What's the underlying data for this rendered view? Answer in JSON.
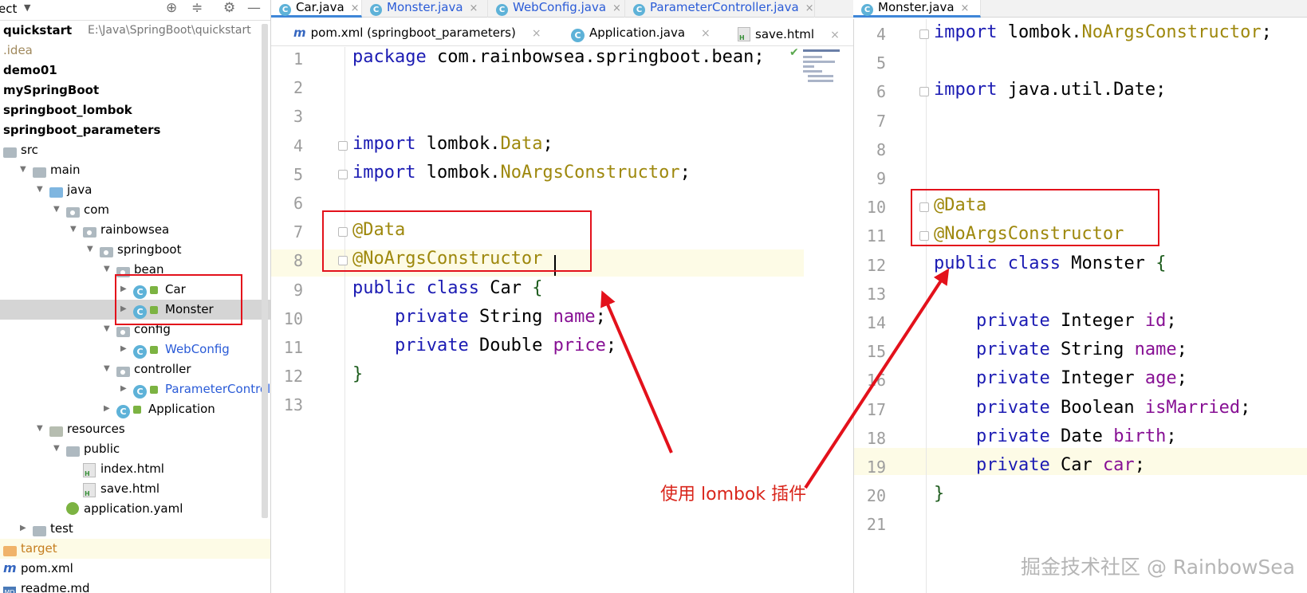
{
  "project": {
    "title": "ect",
    "tree": [
      {
        "label": "quickstart",
        "path": "E:\\Java\\SpringBoot\\quickstart",
        "style": "bold",
        "icon": "none",
        "indent": 0,
        "arrow": ""
      },
      {
        "label": ".idea",
        "style": "dimorange",
        "icon": "none",
        "indent": 0,
        "arrow": ""
      },
      {
        "label": "demo01",
        "style": "bold",
        "icon": "none",
        "indent": 0,
        "arrow": ""
      },
      {
        "label": "mySpringBoot",
        "style": "bold",
        "icon": "none",
        "indent": 0,
        "arrow": ""
      },
      {
        "label": "springboot_lombok",
        "style": "bold",
        "icon": "none",
        "indent": 0,
        "arrow": ""
      },
      {
        "label": "springboot_parameters",
        "style": "bold",
        "icon": "none",
        "indent": 0,
        "arrow": ""
      },
      {
        "label": "src",
        "style": "",
        "icon": "folder",
        "indent": 0,
        "arrow": ""
      },
      {
        "label": "main",
        "style": "",
        "icon": "folder",
        "indent": 1,
        "arrow": "down"
      },
      {
        "label": "java",
        "style": "",
        "icon": "folder-java",
        "indent": 2,
        "arrow": "down"
      },
      {
        "label": "com",
        "style": "",
        "icon": "folder-pkg",
        "indent": 3,
        "arrow": "down"
      },
      {
        "label": "rainbowsea",
        "style": "",
        "icon": "folder-pkg",
        "indent": 4,
        "arrow": "down"
      },
      {
        "label": "springboot",
        "style": "",
        "icon": "folder-pkg",
        "indent": 5,
        "arrow": "down"
      },
      {
        "label": "bean",
        "style": "",
        "icon": "folder-pkg",
        "indent": 6,
        "arrow": "down"
      },
      {
        "label": "Car",
        "style": "",
        "icon": "class",
        "indent": 7,
        "arrow": "right"
      },
      {
        "label": "Monster",
        "style": "",
        "icon": "class",
        "indent": 7,
        "arrow": "right",
        "selected": true
      },
      {
        "label": "config",
        "style": "",
        "icon": "folder-pkg",
        "indent": 6,
        "arrow": "down"
      },
      {
        "label": "WebConfig",
        "style": "blue",
        "icon": "class",
        "indent": 7,
        "arrow": "right"
      },
      {
        "label": "controller",
        "style": "",
        "icon": "folder-pkg",
        "indent": 6,
        "arrow": "down"
      },
      {
        "label": "ParameterControlle",
        "style": "blue",
        "icon": "class",
        "indent": 7,
        "arrow": "right"
      },
      {
        "label": "Application",
        "style": "",
        "icon": "class-app",
        "indent": 6,
        "arrow": "right"
      },
      {
        "label": "resources",
        "style": "",
        "icon": "folder-res",
        "indent": 2,
        "arrow": "down"
      },
      {
        "label": "public",
        "style": "",
        "icon": "folder",
        "indent": 3,
        "arrow": "down"
      },
      {
        "label": "index.html",
        "style": "",
        "icon": "html",
        "indent": 4,
        "arrow": ""
      },
      {
        "label": "save.html",
        "style": "",
        "icon": "html",
        "indent": 4,
        "arrow": ""
      },
      {
        "label": "application.yaml",
        "style": "",
        "icon": "yaml",
        "indent": 3,
        "arrow": ""
      },
      {
        "label": "test",
        "style": "",
        "icon": "folder",
        "indent": 1,
        "arrow": "right"
      },
      {
        "label": "target",
        "style": "orange",
        "icon": "folder-target",
        "indent": 0,
        "arrow": "",
        "target": true
      },
      {
        "label": "pom.xml",
        "style": "",
        "icon": "maven",
        "indent": 0,
        "arrow": ""
      },
      {
        "label": "readme.md",
        "style": "",
        "icon": "md",
        "indent": 0,
        "arrow": ""
      }
    ]
  },
  "tabs_top": [
    {
      "label": "Car.java",
      "active": true
    },
    {
      "label": "Monster.java",
      "active": false
    },
    {
      "label": "WebConfig.java",
      "active": false
    },
    {
      "label": "ParameterController.java",
      "active": false
    }
  ],
  "tabs_second": [
    {
      "label": "pom.xml (springboot_parameters)",
      "icon": "maven"
    },
    {
      "label": "Application.java",
      "icon": "class-app"
    },
    {
      "label": "save.html",
      "icon": "html"
    }
  ],
  "right_tab": {
    "label": "Monster.java"
  },
  "editor_left": {
    "lines": [
      {
        "n": "1",
        "tokens": [
          [
            "kw",
            "package"
          ],
          [
            "t",
            " com.rainbowsea.springboot.bean;"
          ]
        ]
      },
      {
        "n": "2",
        "tokens": []
      },
      {
        "n": "3",
        "tokens": []
      },
      {
        "n": "4",
        "tokens": [
          [
            "kw",
            "import"
          ],
          [
            "t",
            " lombok."
          ],
          [
            "ann",
            "Data"
          ],
          [
            "t",
            ";"
          ]
        ]
      },
      {
        "n": "5",
        "tokens": [
          [
            "kw",
            "import"
          ],
          [
            "t",
            " lombok."
          ],
          [
            "ann",
            "NoArgsConstructor"
          ],
          [
            "t",
            ";"
          ]
        ]
      },
      {
        "n": "6",
        "tokens": []
      },
      {
        "n": "7",
        "tokens": [
          [
            "ann",
            "@Data"
          ]
        ]
      },
      {
        "n": "8",
        "tokens": [
          [
            "ann",
            "@NoArgsConstructor"
          ]
        ]
      },
      {
        "n": "9",
        "tokens": [
          [
            "kw",
            "public"
          ],
          [
            "t",
            " "
          ],
          [
            "kw",
            "class"
          ],
          [
            "t",
            " Car "
          ],
          [
            "brace",
            "{"
          ]
        ]
      },
      {
        "n": "10",
        "tokens": [
          [
            "t",
            "    "
          ],
          [
            "kw",
            "private"
          ],
          [
            "t",
            " String "
          ],
          [
            "fld",
            "name"
          ],
          [
            "t",
            ";"
          ]
        ]
      },
      {
        "n": "11",
        "tokens": [
          [
            "t",
            "    "
          ],
          [
            "kw",
            "private"
          ],
          [
            "t",
            " Double "
          ],
          [
            "fld",
            "price"
          ],
          [
            "t",
            ";"
          ]
        ]
      },
      {
        "n": "12",
        "tokens": [
          [
            "brace",
            "}"
          ]
        ]
      },
      {
        "n": "13",
        "tokens": []
      }
    ]
  },
  "editor_right": {
    "lines": [
      {
        "n": "4",
        "tokens": [
          [
            "kw",
            "import"
          ],
          [
            "t",
            " lombok."
          ],
          [
            "ann",
            "NoArgsConstructor"
          ],
          [
            "t",
            ";"
          ]
        ]
      },
      {
        "n": "5",
        "tokens": []
      },
      {
        "n": "6",
        "tokens": [
          [
            "kw",
            "import"
          ],
          [
            "t",
            " java.util.Date;"
          ]
        ]
      },
      {
        "n": "7",
        "tokens": []
      },
      {
        "n": "8",
        "tokens": []
      },
      {
        "n": "9",
        "tokens": []
      },
      {
        "n": "10",
        "tokens": [
          [
            "ann",
            "@Data"
          ]
        ]
      },
      {
        "n": "11",
        "tokens": [
          [
            "ann",
            "@NoArgsConstructor"
          ]
        ]
      },
      {
        "n": "12",
        "tokens": [
          [
            "kw",
            "public"
          ],
          [
            "t",
            " "
          ],
          [
            "kw",
            "class"
          ],
          [
            "t",
            " Monster "
          ],
          [
            "brace",
            "{"
          ]
        ]
      },
      {
        "n": "13",
        "tokens": []
      },
      {
        "n": "14",
        "tokens": [
          [
            "t",
            "    "
          ],
          [
            "kw",
            "private"
          ],
          [
            "t",
            " Integer "
          ],
          [
            "fld",
            "id"
          ],
          [
            "t",
            ";"
          ]
        ]
      },
      {
        "n": "15",
        "tokens": [
          [
            "t",
            "    "
          ],
          [
            "kw",
            "private"
          ],
          [
            "t",
            " String "
          ],
          [
            "fld",
            "name"
          ],
          [
            "t",
            ";"
          ]
        ]
      },
      {
        "n": "16",
        "tokens": [
          [
            "t",
            "    "
          ],
          [
            "kw",
            "private"
          ],
          [
            "t",
            " Integer "
          ],
          [
            "fld",
            "age"
          ],
          [
            "t",
            ";"
          ]
        ]
      },
      {
        "n": "17",
        "tokens": [
          [
            "t",
            "    "
          ],
          [
            "kw",
            "private"
          ],
          [
            "t",
            " Boolean "
          ],
          [
            "fld",
            "isMarried"
          ],
          [
            "t",
            ";"
          ]
        ]
      },
      {
        "n": "18",
        "tokens": [
          [
            "t",
            "    "
          ],
          [
            "kw",
            "private"
          ],
          [
            "t",
            " Date "
          ],
          [
            "fld",
            "birth"
          ],
          [
            "t",
            ";"
          ]
        ]
      },
      {
        "n": "19",
        "tokens": [
          [
            "t",
            "    "
          ],
          [
            "kw",
            "private"
          ],
          [
            "t",
            " Car "
          ],
          [
            "fld",
            "car"
          ],
          [
            "t",
            ";"
          ]
        ]
      },
      {
        "n": "20",
        "tokens": [
          [
            "brace",
            "}"
          ]
        ]
      },
      {
        "n": "21",
        "tokens": []
      }
    ]
  },
  "annotation": {
    "note": "使用 lombok 插件",
    "color": "#e3111b"
  },
  "watermark": "掘金技术社区 @ RainbowSea",
  "icons": {
    "locate": "crosshair-icon",
    "collapse": "collapse-icon",
    "settings": "gear-icon",
    "hide": "minimize-icon"
  }
}
